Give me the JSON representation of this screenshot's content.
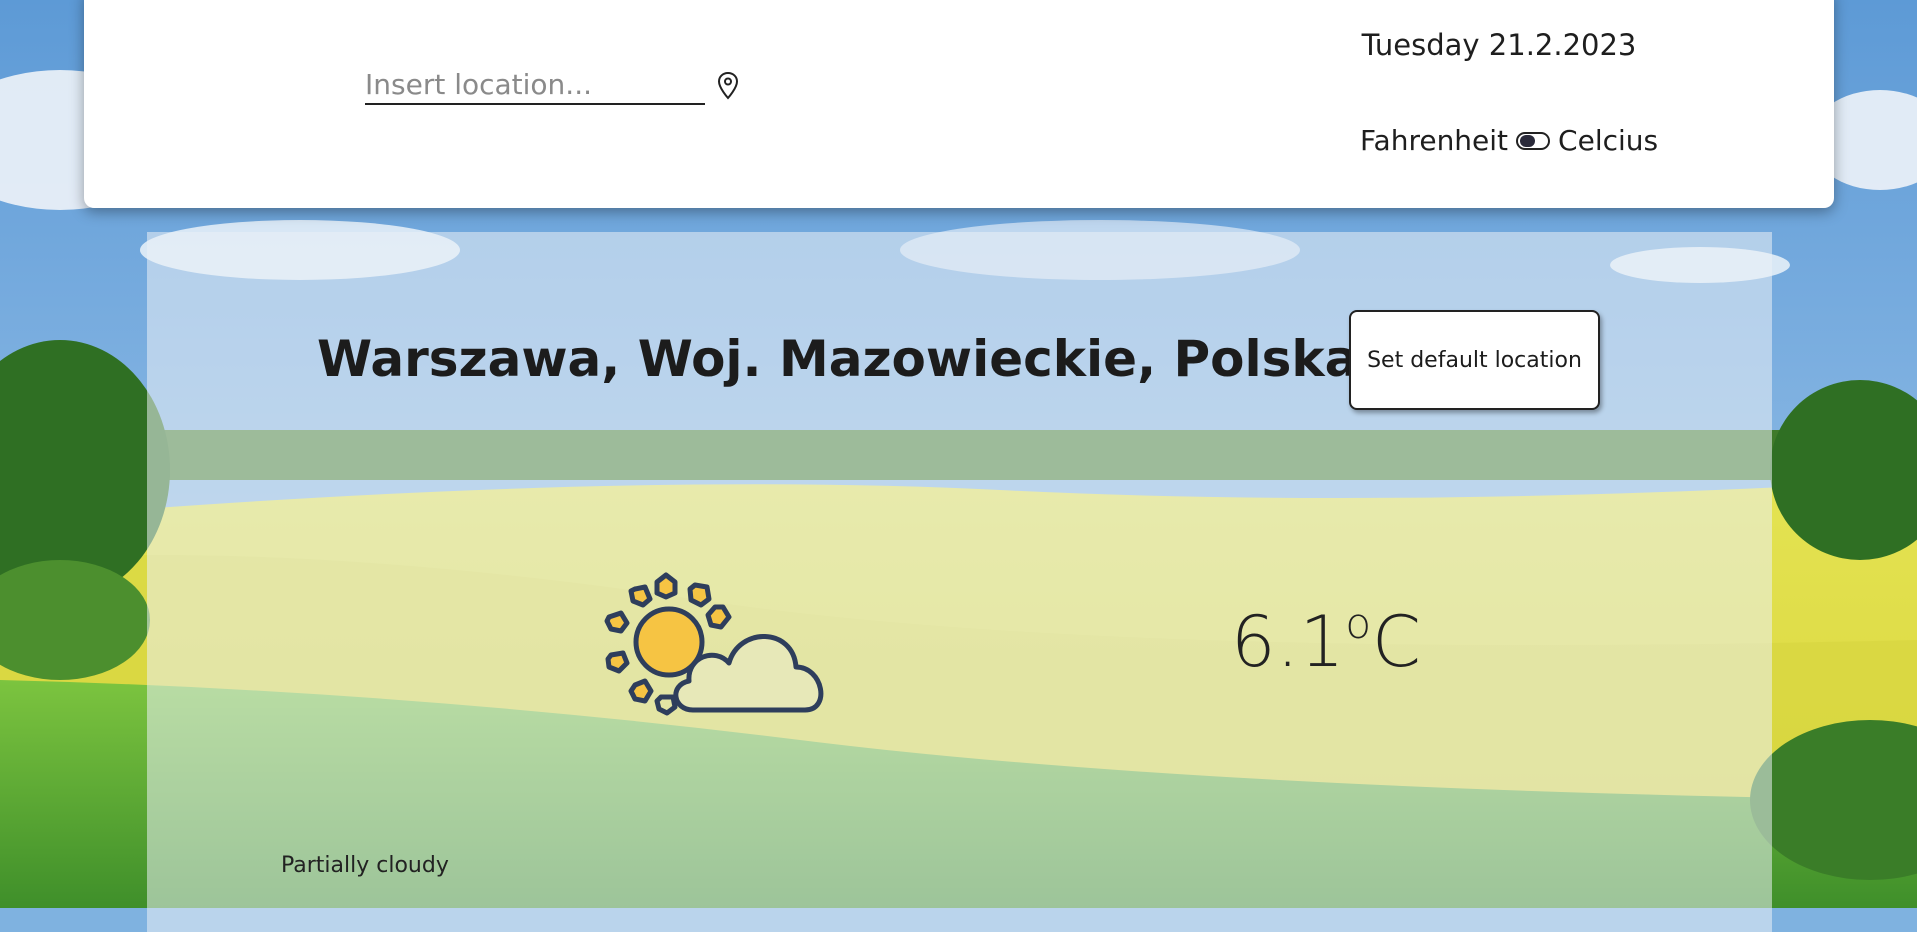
{
  "header": {
    "search": {
      "placeholder": "Insert location...",
      "value": ""
    },
    "date": "Tuesday 21.2.2023",
    "units": {
      "left_label": "Fahrenheit",
      "right_label": "Celcius",
      "selected": "Celcius"
    }
  },
  "weather": {
    "city": "Warszawa, Woj. Mazowieckie, Polska",
    "default_button": "Set default location",
    "icon": "partly-cloudy-day-icon",
    "temperature_value": "6.1",
    "temperature_deg": "o",
    "temperature_unit": "C",
    "condition": "Partially cloudy"
  },
  "colors": {
    "icon_outline": "#2e3e5c",
    "sun_fill": "#f6c443",
    "text": "#1e1e1e"
  }
}
